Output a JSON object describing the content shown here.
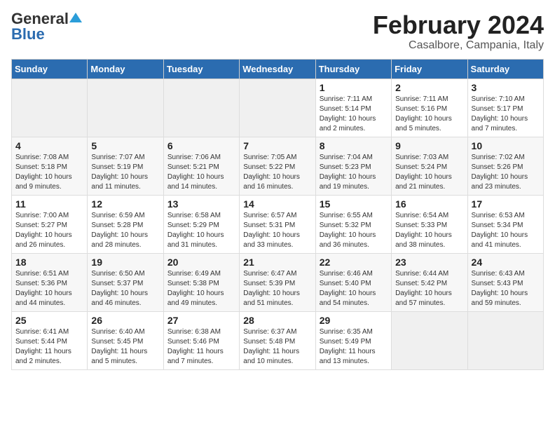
{
  "logo": {
    "general": "General",
    "blue": "Blue"
  },
  "title": "February 2024",
  "subtitle": "Casalbore, Campania, Italy",
  "headers": [
    "Sunday",
    "Monday",
    "Tuesday",
    "Wednesday",
    "Thursday",
    "Friday",
    "Saturday"
  ],
  "weeks": [
    [
      {
        "day": "",
        "info": ""
      },
      {
        "day": "",
        "info": ""
      },
      {
        "day": "",
        "info": ""
      },
      {
        "day": "",
        "info": ""
      },
      {
        "day": "1",
        "info": "Sunrise: 7:11 AM\nSunset: 5:14 PM\nDaylight: 10 hours\nand 2 minutes."
      },
      {
        "day": "2",
        "info": "Sunrise: 7:11 AM\nSunset: 5:16 PM\nDaylight: 10 hours\nand 5 minutes."
      },
      {
        "day": "3",
        "info": "Sunrise: 7:10 AM\nSunset: 5:17 PM\nDaylight: 10 hours\nand 7 minutes."
      }
    ],
    [
      {
        "day": "4",
        "info": "Sunrise: 7:08 AM\nSunset: 5:18 PM\nDaylight: 10 hours\nand 9 minutes."
      },
      {
        "day": "5",
        "info": "Sunrise: 7:07 AM\nSunset: 5:19 PM\nDaylight: 10 hours\nand 11 minutes."
      },
      {
        "day": "6",
        "info": "Sunrise: 7:06 AM\nSunset: 5:21 PM\nDaylight: 10 hours\nand 14 minutes."
      },
      {
        "day": "7",
        "info": "Sunrise: 7:05 AM\nSunset: 5:22 PM\nDaylight: 10 hours\nand 16 minutes."
      },
      {
        "day": "8",
        "info": "Sunrise: 7:04 AM\nSunset: 5:23 PM\nDaylight: 10 hours\nand 19 minutes."
      },
      {
        "day": "9",
        "info": "Sunrise: 7:03 AM\nSunset: 5:24 PM\nDaylight: 10 hours\nand 21 minutes."
      },
      {
        "day": "10",
        "info": "Sunrise: 7:02 AM\nSunset: 5:26 PM\nDaylight: 10 hours\nand 23 minutes."
      }
    ],
    [
      {
        "day": "11",
        "info": "Sunrise: 7:00 AM\nSunset: 5:27 PM\nDaylight: 10 hours\nand 26 minutes."
      },
      {
        "day": "12",
        "info": "Sunrise: 6:59 AM\nSunset: 5:28 PM\nDaylight: 10 hours\nand 28 minutes."
      },
      {
        "day": "13",
        "info": "Sunrise: 6:58 AM\nSunset: 5:29 PM\nDaylight: 10 hours\nand 31 minutes."
      },
      {
        "day": "14",
        "info": "Sunrise: 6:57 AM\nSunset: 5:31 PM\nDaylight: 10 hours\nand 33 minutes."
      },
      {
        "day": "15",
        "info": "Sunrise: 6:55 AM\nSunset: 5:32 PM\nDaylight: 10 hours\nand 36 minutes."
      },
      {
        "day": "16",
        "info": "Sunrise: 6:54 AM\nSunset: 5:33 PM\nDaylight: 10 hours\nand 38 minutes."
      },
      {
        "day": "17",
        "info": "Sunrise: 6:53 AM\nSunset: 5:34 PM\nDaylight: 10 hours\nand 41 minutes."
      }
    ],
    [
      {
        "day": "18",
        "info": "Sunrise: 6:51 AM\nSunset: 5:36 PM\nDaylight: 10 hours\nand 44 minutes."
      },
      {
        "day": "19",
        "info": "Sunrise: 6:50 AM\nSunset: 5:37 PM\nDaylight: 10 hours\nand 46 minutes."
      },
      {
        "day": "20",
        "info": "Sunrise: 6:49 AM\nSunset: 5:38 PM\nDaylight: 10 hours\nand 49 minutes."
      },
      {
        "day": "21",
        "info": "Sunrise: 6:47 AM\nSunset: 5:39 PM\nDaylight: 10 hours\nand 51 minutes."
      },
      {
        "day": "22",
        "info": "Sunrise: 6:46 AM\nSunset: 5:40 PM\nDaylight: 10 hours\nand 54 minutes."
      },
      {
        "day": "23",
        "info": "Sunrise: 6:44 AM\nSunset: 5:42 PM\nDaylight: 10 hours\nand 57 minutes."
      },
      {
        "day": "24",
        "info": "Sunrise: 6:43 AM\nSunset: 5:43 PM\nDaylight: 10 hours\nand 59 minutes."
      }
    ],
    [
      {
        "day": "25",
        "info": "Sunrise: 6:41 AM\nSunset: 5:44 PM\nDaylight: 11 hours\nand 2 minutes."
      },
      {
        "day": "26",
        "info": "Sunrise: 6:40 AM\nSunset: 5:45 PM\nDaylight: 11 hours\nand 5 minutes."
      },
      {
        "day": "27",
        "info": "Sunrise: 6:38 AM\nSunset: 5:46 PM\nDaylight: 11 hours\nand 7 minutes."
      },
      {
        "day": "28",
        "info": "Sunrise: 6:37 AM\nSunset: 5:48 PM\nDaylight: 11 hours\nand 10 minutes."
      },
      {
        "day": "29",
        "info": "Sunrise: 6:35 AM\nSunset: 5:49 PM\nDaylight: 11 hours\nand 13 minutes."
      },
      {
        "day": "",
        "info": ""
      },
      {
        "day": "",
        "info": ""
      }
    ]
  ]
}
